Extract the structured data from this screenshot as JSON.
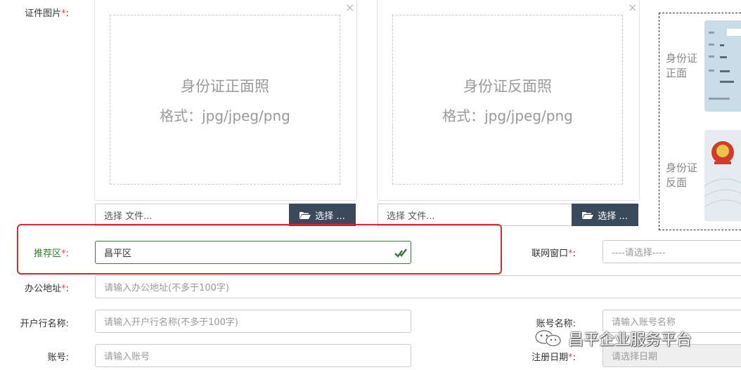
{
  "form": {
    "id_photos": {
      "label": "证件图片",
      "front": {
        "title": "身份证正面照",
        "format": "格式：jpg/jpeg/png",
        "file_placeholder": "选择 文件...",
        "button": "选择 ..."
      },
      "back": {
        "title": "身份证反面照",
        "format": "格式：jpg/jpeg/png",
        "file_placeholder": "选择 文件...",
        "button": "选择 ..."
      },
      "close": "×",
      "sample": {
        "front_label": "身份证正面",
        "back_label": "身份证反面"
      }
    },
    "district": {
      "label": "推荐区",
      "value": "昌平区"
    },
    "network_window": {
      "label": "联网窗口",
      "placeholder": "----请选择----"
    },
    "office_address": {
      "label": "办公地址",
      "placeholder": "请输入办公地址(不多于100字)"
    },
    "bank_name": {
      "label": "开户行名称",
      "placeholder": "请输入开户行名称(不多于100字)"
    },
    "account_name": {
      "label": "账号名称",
      "placeholder": "请输入账号名称"
    },
    "account_no": {
      "label": "账号",
      "placeholder": "请输入账号"
    },
    "reg_date": {
      "label": "注册日期",
      "placeholder": "请选择日期"
    }
  },
  "watermark": {
    "text": "昌平企业服务平台"
  },
  "colors": {
    "highlight": "#d62a2a",
    "label_green": "#3a7d2c",
    "button_dark": "#3b4a5a",
    "required": "#d9534f"
  }
}
